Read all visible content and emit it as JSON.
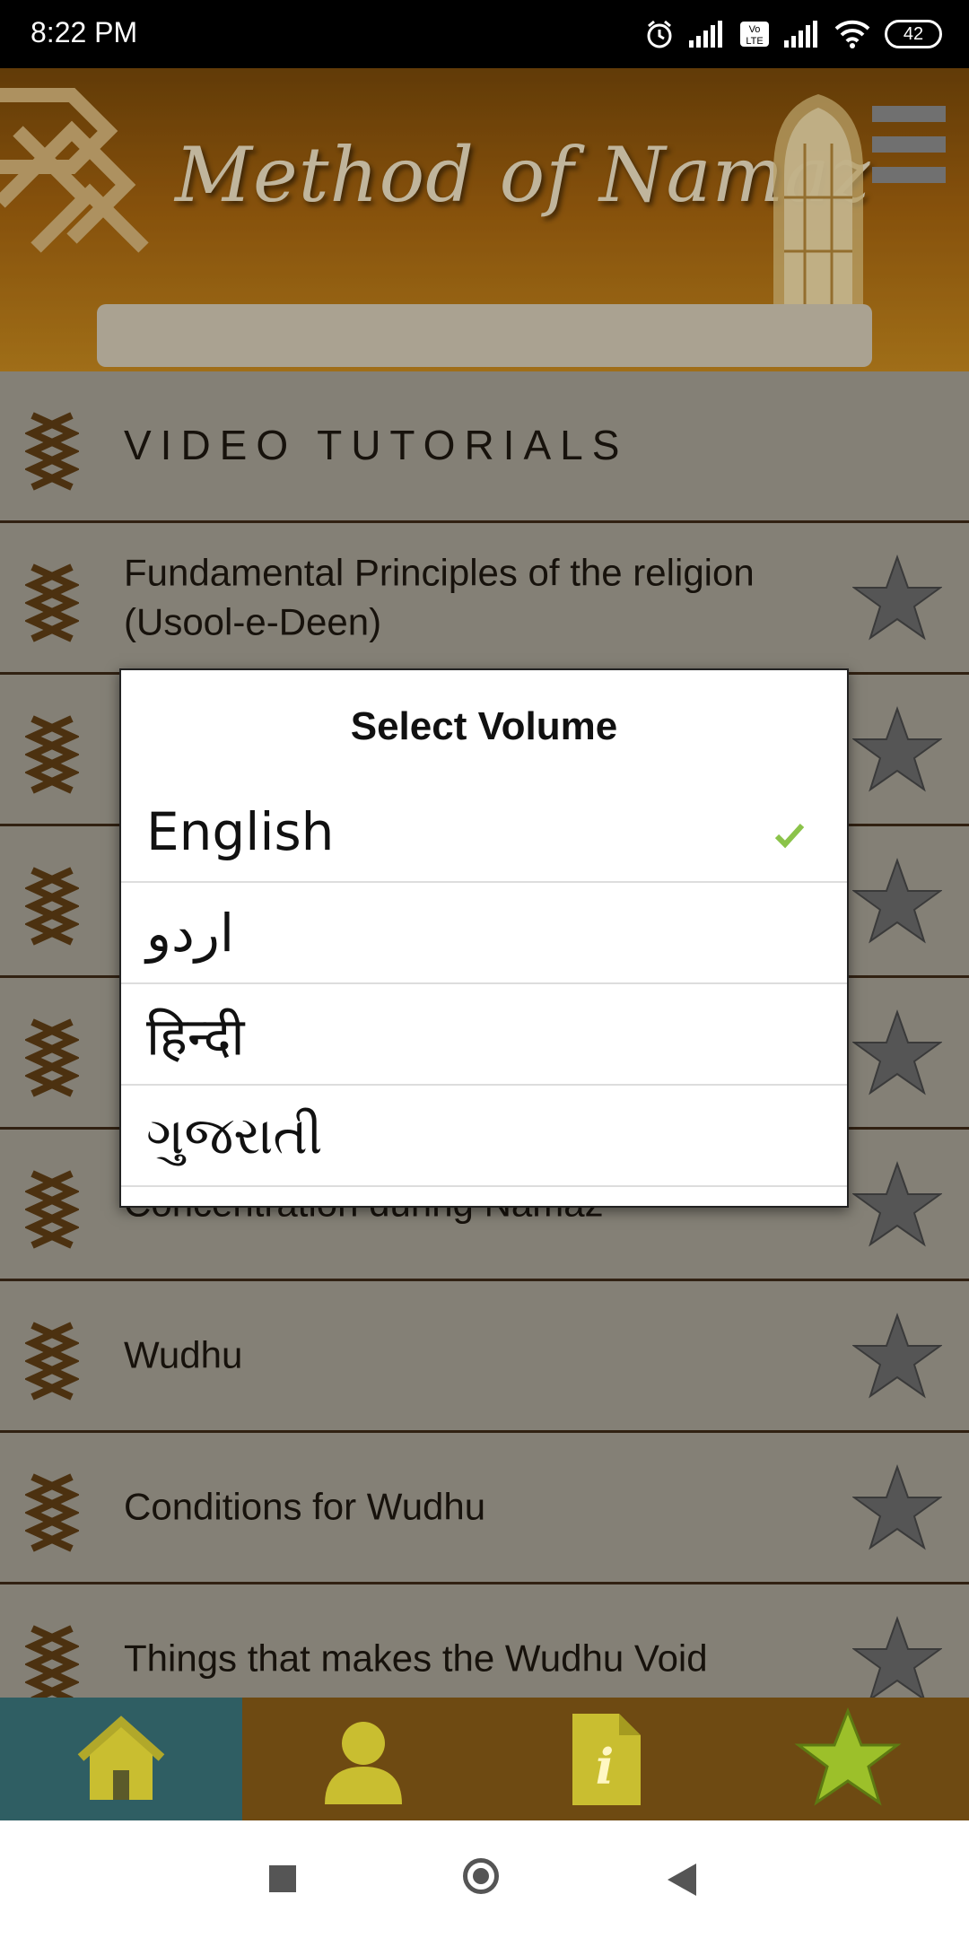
{
  "status_bar": {
    "time": "8:22 PM",
    "battery": "42"
  },
  "header": {
    "title": "Method of Namaz",
    "icons": [
      "ornament-knot-icon",
      "arched-window-icon",
      "hamburger-menu-icon"
    ]
  },
  "list": {
    "items": [
      {
        "label": "VIDEO TUTORIALS",
        "starred": false,
        "has_star": false
      },
      {
        "label": "Fundamental Principles of the religion (Usool-e-Deen)",
        "has_star": true
      },
      {
        "label": "",
        "has_star": true
      },
      {
        "label": "",
        "has_star": true
      },
      {
        "label": "",
        "has_star": true
      },
      {
        "label": "Concentration during Namaz",
        "has_star": true
      },
      {
        "label": "Wudhu",
        "has_star": true
      },
      {
        "label": "Conditions for Wudhu",
        "has_star": true
      },
      {
        "label": "Things that makes the Wudhu Void",
        "has_star": true
      }
    ]
  },
  "dialog": {
    "title": "Select Volume",
    "options": [
      {
        "label": "English",
        "selected": true
      },
      {
        "label": "اردو",
        "selected": false
      },
      {
        "label": "हिन्दी",
        "selected": false
      },
      {
        "label": "ગુજરાતી",
        "selected": false
      }
    ]
  },
  "bottom_nav": {
    "items": [
      {
        "icon": "home-icon",
        "active": true
      },
      {
        "icon": "profile-icon",
        "active": false
      },
      {
        "icon": "info-document-icon",
        "active": false
      },
      {
        "icon": "favorites-star-icon",
        "active": false
      }
    ]
  },
  "colors": {
    "header": "#a7650f",
    "nav_bg": "#6e4a12",
    "nav_active": "#2f5e63",
    "check": "#8bc34a"
  }
}
